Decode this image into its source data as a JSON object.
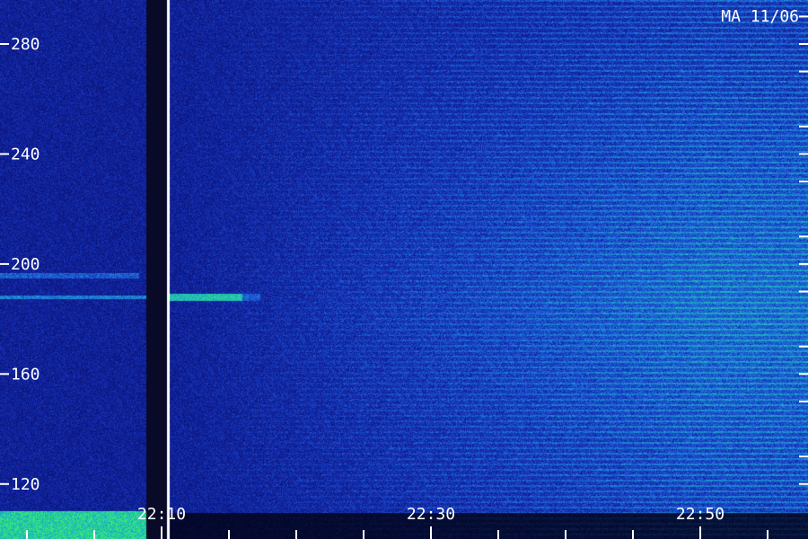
{
  "station_label": "MA 11/06",
  "chart_data": {
    "type": "heatmap",
    "title": "",
    "xlabel": "",
    "ylabel": "",
    "x_tick_labels": [
      "22:10",
      "22:30",
      "22:50"
    ],
    "x_ticks_minutes": [
      0,
      20,
      40
    ],
    "x_range_minutes": [
      -12,
      48
    ],
    "y_tick_labels": [
      "280",
      "240",
      "200",
      "160",
      "120"
    ],
    "y_ticks": [
      280,
      240,
      200,
      160,
      120
    ],
    "ylim": [
      100,
      296
    ],
    "features": {
      "data_gap_minutes": [
        -1.2,
        0.4
      ],
      "bright_band_y": 188,
      "band_start_minutes": 1,
      "band_end_minutes": 6,
      "upper_band_y": 196
    },
    "colors": {
      "background": "#0b1a7a",
      "low": "#0a1c8c",
      "mid": "#1f6fd8",
      "high": "#23d18b",
      "peak": "#3cff6a",
      "axis": "#ffffff"
    }
  }
}
